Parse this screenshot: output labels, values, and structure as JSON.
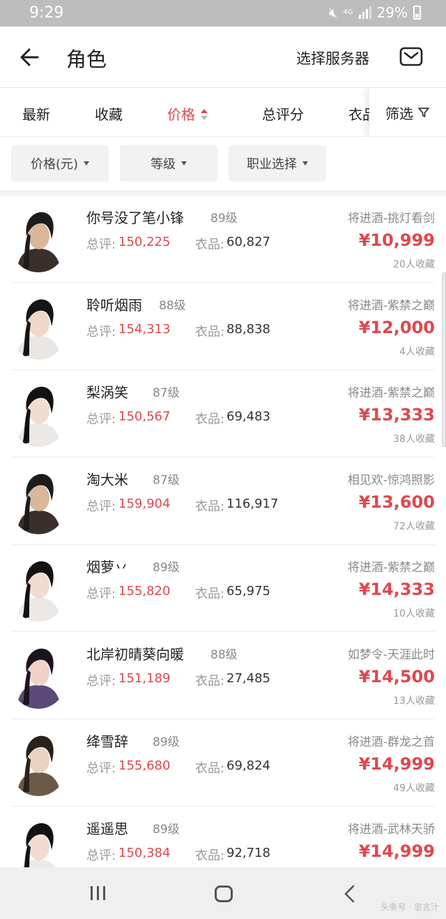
{
  "status_bar": {
    "time": "9:29",
    "network": "4G",
    "battery": "29%"
  },
  "header": {
    "title": "角色",
    "select_server": "选择服务器"
  },
  "tabs": [
    {
      "label": "最新",
      "active": false
    },
    {
      "label": "收藏",
      "active": false
    },
    {
      "label": "价格",
      "active": true
    },
    {
      "label": "总评分",
      "active": false
    },
    {
      "label": "衣品",
      "active": false
    }
  ],
  "filter": {
    "label": "筛选"
  },
  "chips": [
    {
      "label": "价格(元)"
    },
    {
      "label": "等级"
    },
    {
      "label": "职业选择"
    }
  ],
  "labels": {
    "score": "总评:",
    "fashion": "衣品:"
  },
  "roles": [
    {
      "name": "你号没了笔小锋",
      "level": "89级",
      "score": "150,225",
      "fashion": "60,827",
      "server": "将进酒-挑灯看剑",
      "price": "¥10,999",
      "favorites": "20人收藏"
    },
    {
      "name": "聆听烟雨",
      "level": "88级",
      "score": "154,313",
      "fashion": "88,838",
      "server": "将进酒-紫禁之巅",
      "price": "¥12,000",
      "favorites": "4人收藏"
    },
    {
      "name": "梨涡笑",
      "level": "87级",
      "score": "150,567",
      "fashion": "69,483",
      "server": "将进酒-紫禁之巅",
      "price": "¥13,333",
      "favorites": "38人收藏"
    },
    {
      "name": "淘大米",
      "level": "87级",
      "score": "159,904",
      "fashion": "116,917",
      "server": "相见欢-惊鸿照影",
      "price": "¥13,600",
      "favorites": "72人收藏"
    },
    {
      "name": "烟萝丷",
      "level": "89级",
      "score": "155,820",
      "fashion": "65,975",
      "server": "将进酒-紫禁之巅",
      "price": "¥14,333",
      "favorites": "10人收藏"
    },
    {
      "name": "北岸初晴葵向暖",
      "level": "88级",
      "score": "151,189",
      "fashion": "27,485",
      "server": "如梦令-天涯此时",
      "price": "¥14,500",
      "favorites": "13人收藏"
    },
    {
      "name": "绛雪辞",
      "level": "89级",
      "score": "155,680",
      "fashion": "69,824",
      "server": "将进酒-群龙之首",
      "price": "¥14,999",
      "favorites": "49人收藏"
    },
    {
      "name": "遥遥思",
      "level": "89级",
      "score": "150,384",
      "fashion": "92,718",
      "server": "将进酒-武林天骄",
      "price": "¥14,999",
      "favorites": ""
    }
  ],
  "watermark": "头条号 · 忠言汁",
  "colors": {
    "accent": "#e0474c",
    "status_bar": "#bdbdbd"
  }
}
